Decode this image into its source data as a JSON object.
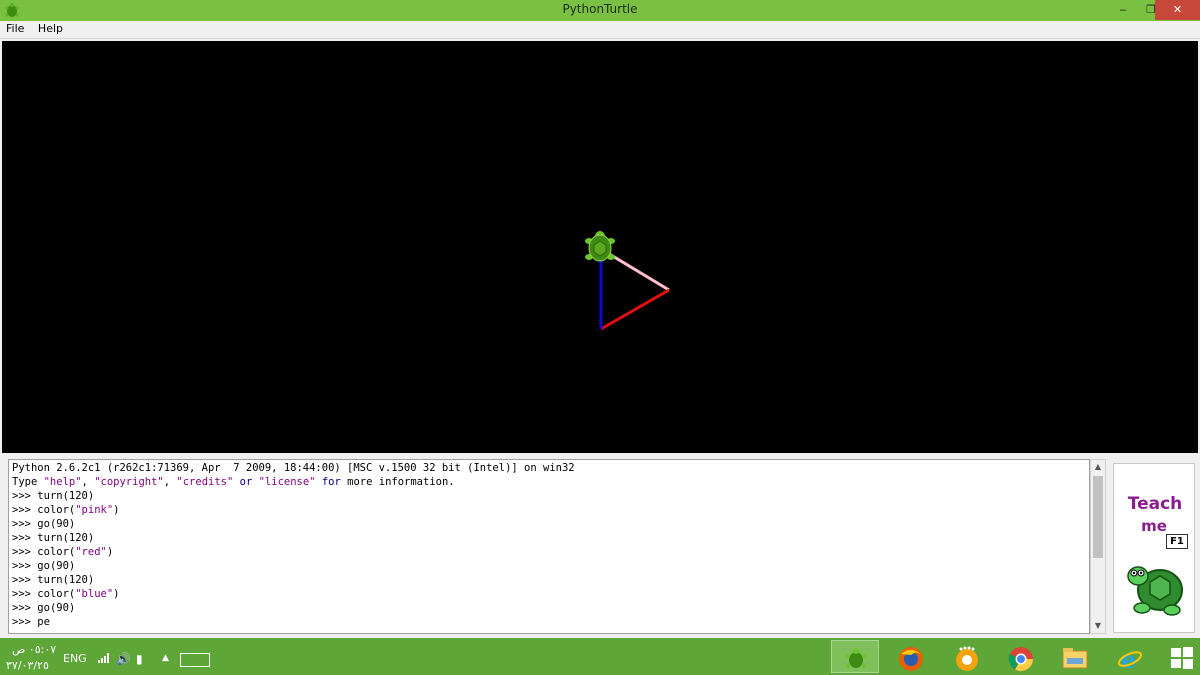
{
  "window": {
    "title": "PythonTurtle",
    "minimize_icon": "minimize-icon",
    "maximize_icon": "restore-icon",
    "close_icon": "close-icon",
    "minimize_glyph": "‒",
    "maximize_glyph": "❐",
    "close_glyph": "✕"
  },
  "menu": [
    "File",
    "Help"
  ],
  "canvas": {
    "background": "#000000",
    "turtle_icon": "turtle-icon",
    "drawing": [
      {
        "color": "pink",
        "length": 90
      },
      {
        "color": "red",
        "length": 90
      },
      {
        "color": "blue",
        "length": 90
      }
    ]
  },
  "shell": {
    "header_line1": "Python 2.6.2c1 (r262c1:71369, Apr  7 2009, 18:44:00) [MSC v.1500 32 bit (Intel)] on win32",
    "header_line2": {
      "type_word": "Type ",
      "help": "\"help\"",
      "sep1": ", ",
      "copyright": "\"copyright\"",
      "sep2": ", ",
      "credits": "\"credits\"",
      "or": " or ",
      "license": "\"license\"",
      "for": " for",
      "rest": " more information."
    },
    "history": [
      {
        "prompt": ">>> ",
        "code": "turn(120)"
      },
      {
        "prompt": ">>> ",
        "code": "color(",
        "str": "\"pink\"",
        "tail": ")"
      },
      {
        "prompt": ">>> ",
        "code": "go(90)"
      },
      {
        "prompt": ">>> ",
        "code": "turn(120)"
      },
      {
        "prompt": ">>> ",
        "code": "color(",
        "str": "\"red\"",
        "tail": ")"
      },
      {
        "prompt": ">>> ",
        "code": "go(90)"
      },
      {
        "prompt": ">>> ",
        "code": "turn(120)"
      },
      {
        "prompt": ">>> ",
        "code": "color(",
        "str": "\"blue\"",
        "tail": ")"
      },
      {
        "prompt": ">>> ",
        "code": "go(90)"
      },
      {
        "prompt": ">>> ",
        "code": "pe"
      }
    ],
    "scroll_up_glyph": "▲",
    "scroll_down_glyph": "▼"
  },
  "teach_panel": {
    "line1": "Teach",
    "line2": "me",
    "shortcut": "F1",
    "icon": "teach-turtle-icon"
  },
  "taskbar": {
    "time": "٠٥:٠٧ ص",
    "date": "٣٧/٠٣/٢٥",
    "lang": "ENG",
    "signal_icon": "signal-icon",
    "volume_icon": "volume-icon",
    "volume_glyph": "🔊",
    "power_icon": "battery-icon",
    "power_glyph": "▮",
    "tray_up_glyph": "▲",
    "keyboard_icon": "keyboard-icon",
    "apps": [
      {
        "name": "pythonturtle",
        "icon": "turtle-taskbar-icon",
        "active": true
      },
      {
        "name": "firefox",
        "icon": "firefox-icon",
        "active": false
      },
      {
        "name": "kmplayer",
        "icon": "media-player-icon",
        "active": false
      },
      {
        "name": "chrome",
        "icon": "chrome-icon",
        "active": false
      },
      {
        "name": "explorer",
        "icon": "file-explorer-icon",
        "active": false
      },
      {
        "name": "ie",
        "icon": "internet-explorer-icon",
        "active": false
      },
      {
        "name": "windows",
        "icon": "windows-logo-icon",
        "active": false
      }
    ]
  }
}
